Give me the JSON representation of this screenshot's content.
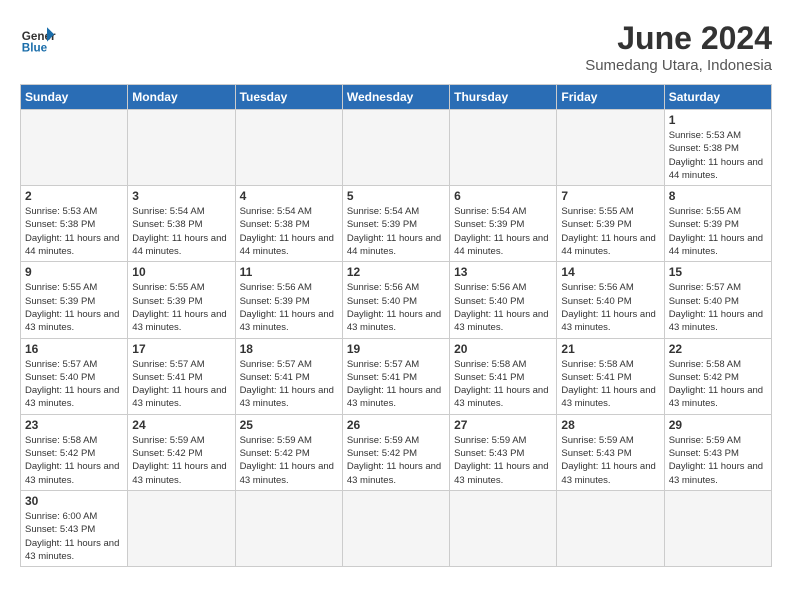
{
  "header": {
    "logo_general": "General",
    "logo_blue": "Blue",
    "month_title": "June 2024",
    "subtitle": "Sumedang Utara, Indonesia"
  },
  "days_of_week": [
    "Sunday",
    "Monday",
    "Tuesday",
    "Wednesday",
    "Thursday",
    "Friday",
    "Saturday"
  ],
  "weeks": [
    [
      {
        "day": "",
        "info": ""
      },
      {
        "day": "",
        "info": ""
      },
      {
        "day": "",
        "info": ""
      },
      {
        "day": "",
        "info": ""
      },
      {
        "day": "",
        "info": ""
      },
      {
        "day": "",
        "info": ""
      },
      {
        "day": "1",
        "info": "Sunrise: 5:53 AM\nSunset: 5:38 PM\nDaylight: 11 hours and 44 minutes."
      }
    ],
    [
      {
        "day": "2",
        "info": "Sunrise: 5:53 AM\nSunset: 5:38 PM\nDaylight: 11 hours and 44 minutes."
      },
      {
        "day": "3",
        "info": "Sunrise: 5:54 AM\nSunset: 5:38 PM\nDaylight: 11 hours and 44 minutes."
      },
      {
        "day": "4",
        "info": "Sunrise: 5:54 AM\nSunset: 5:38 PM\nDaylight: 11 hours and 44 minutes."
      },
      {
        "day": "5",
        "info": "Sunrise: 5:54 AM\nSunset: 5:39 PM\nDaylight: 11 hours and 44 minutes."
      },
      {
        "day": "6",
        "info": "Sunrise: 5:54 AM\nSunset: 5:39 PM\nDaylight: 11 hours and 44 minutes."
      },
      {
        "day": "7",
        "info": "Sunrise: 5:55 AM\nSunset: 5:39 PM\nDaylight: 11 hours and 44 minutes."
      },
      {
        "day": "8",
        "info": "Sunrise: 5:55 AM\nSunset: 5:39 PM\nDaylight: 11 hours and 44 minutes."
      }
    ],
    [
      {
        "day": "9",
        "info": "Sunrise: 5:55 AM\nSunset: 5:39 PM\nDaylight: 11 hours and 43 minutes."
      },
      {
        "day": "10",
        "info": "Sunrise: 5:55 AM\nSunset: 5:39 PM\nDaylight: 11 hours and 43 minutes."
      },
      {
        "day": "11",
        "info": "Sunrise: 5:56 AM\nSunset: 5:39 PM\nDaylight: 11 hours and 43 minutes."
      },
      {
        "day": "12",
        "info": "Sunrise: 5:56 AM\nSunset: 5:40 PM\nDaylight: 11 hours and 43 minutes."
      },
      {
        "day": "13",
        "info": "Sunrise: 5:56 AM\nSunset: 5:40 PM\nDaylight: 11 hours and 43 minutes."
      },
      {
        "day": "14",
        "info": "Sunrise: 5:56 AM\nSunset: 5:40 PM\nDaylight: 11 hours and 43 minutes."
      },
      {
        "day": "15",
        "info": "Sunrise: 5:57 AM\nSunset: 5:40 PM\nDaylight: 11 hours and 43 minutes."
      }
    ],
    [
      {
        "day": "16",
        "info": "Sunrise: 5:57 AM\nSunset: 5:40 PM\nDaylight: 11 hours and 43 minutes."
      },
      {
        "day": "17",
        "info": "Sunrise: 5:57 AM\nSunset: 5:41 PM\nDaylight: 11 hours and 43 minutes."
      },
      {
        "day": "18",
        "info": "Sunrise: 5:57 AM\nSunset: 5:41 PM\nDaylight: 11 hours and 43 minutes."
      },
      {
        "day": "19",
        "info": "Sunrise: 5:57 AM\nSunset: 5:41 PM\nDaylight: 11 hours and 43 minutes."
      },
      {
        "day": "20",
        "info": "Sunrise: 5:58 AM\nSunset: 5:41 PM\nDaylight: 11 hours and 43 minutes."
      },
      {
        "day": "21",
        "info": "Sunrise: 5:58 AM\nSunset: 5:41 PM\nDaylight: 11 hours and 43 minutes."
      },
      {
        "day": "22",
        "info": "Sunrise: 5:58 AM\nSunset: 5:42 PM\nDaylight: 11 hours and 43 minutes."
      }
    ],
    [
      {
        "day": "23",
        "info": "Sunrise: 5:58 AM\nSunset: 5:42 PM\nDaylight: 11 hours and 43 minutes."
      },
      {
        "day": "24",
        "info": "Sunrise: 5:59 AM\nSunset: 5:42 PM\nDaylight: 11 hours and 43 minutes."
      },
      {
        "day": "25",
        "info": "Sunrise: 5:59 AM\nSunset: 5:42 PM\nDaylight: 11 hours and 43 minutes."
      },
      {
        "day": "26",
        "info": "Sunrise: 5:59 AM\nSunset: 5:42 PM\nDaylight: 11 hours and 43 minutes."
      },
      {
        "day": "27",
        "info": "Sunrise: 5:59 AM\nSunset: 5:43 PM\nDaylight: 11 hours and 43 minutes."
      },
      {
        "day": "28",
        "info": "Sunrise: 5:59 AM\nSunset: 5:43 PM\nDaylight: 11 hours and 43 minutes."
      },
      {
        "day": "29",
        "info": "Sunrise: 5:59 AM\nSunset: 5:43 PM\nDaylight: 11 hours and 43 minutes."
      }
    ],
    [
      {
        "day": "30",
        "info": "Sunrise: 6:00 AM\nSunset: 5:43 PM\nDaylight: 11 hours and 43 minutes."
      },
      {
        "day": "",
        "info": ""
      },
      {
        "day": "",
        "info": ""
      },
      {
        "day": "",
        "info": ""
      },
      {
        "day": "",
        "info": ""
      },
      {
        "day": "",
        "info": ""
      },
      {
        "day": "",
        "info": ""
      }
    ]
  ]
}
